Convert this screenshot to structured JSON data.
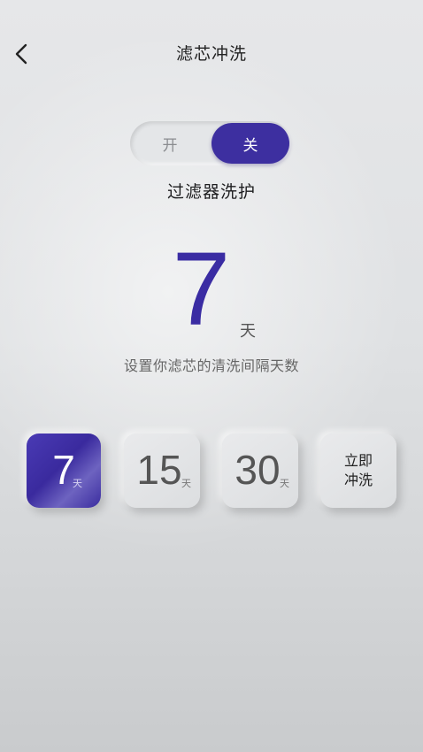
{
  "header": {
    "title": "滤芯冲洗",
    "back_icon": "chevron-left-icon"
  },
  "toggle": {
    "on_label": "开",
    "off_label": "关",
    "selected": "关"
  },
  "section": {
    "subtitle": "过滤器洗护"
  },
  "display": {
    "value": "7",
    "unit": "天",
    "hint": "设置你滤芯的清洗间隔天数"
  },
  "options": [
    {
      "value": "7",
      "unit": "天",
      "selected": true
    },
    {
      "value": "15",
      "unit": "天",
      "selected": false
    },
    {
      "value": "30",
      "unit": "天",
      "selected": false
    }
  ],
  "flush_button": {
    "label": "立即\n冲洗"
  },
  "colors": {
    "accent": "#3d2fa0",
    "background": "#e1e3e5",
    "text": "#222222"
  }
}
